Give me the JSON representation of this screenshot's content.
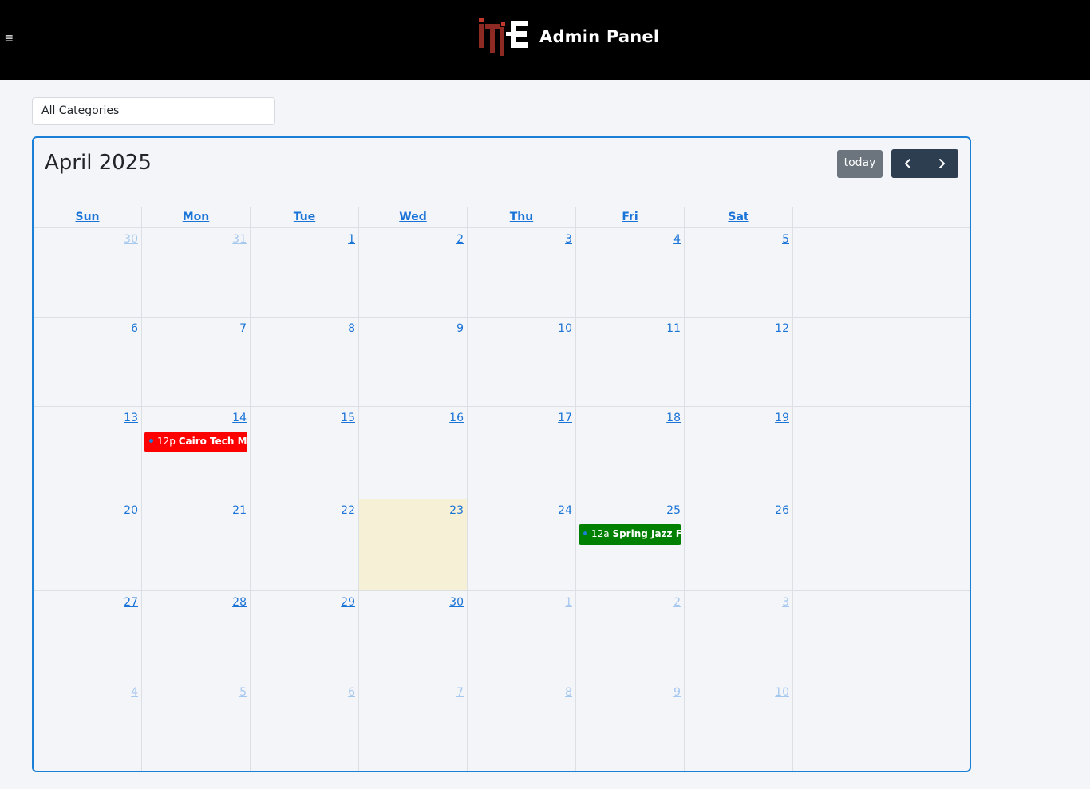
{
  "header": {
    "title": "Admin Panel",
    "menu_icon": "hamburger-icon"
  },
  "filter": {
    "selected": "All Categories"
  },
  "calendar": {
    "title": "April 2025",
    "today_label": "today",
    "weekdays": [
      "Sun",
      "Mon",
      "Tue",
      "Wed",
      "Thu",
      "Fri",
      "Sat"
    ],
    "weeks": [
      [
        {
          "d": "30",
          "o": true
        },
        {
          "d": "31",
          "o": true
        },
        {
          "d": "1"
        },
        {
          "d": "2"
        },
        {
          "d": "3"
        },
        {
          "d": "4"
        },
        {
          "d": "5"
        }
      ],
      [
        {
          "d": "6"
        },
        {
          "d": "7"
        },
        {
          "d": "8"
        },
        {
          "d": "9"
        },
        {
          "d": "10"
        },
        {
          "d": "11"
        },
        {
          "d": "12"
        }
      ],
      [
        {
          "d": "13"
        },
        {
          "d": "14",
          "event": {
            "time": "12p",
            "title": "Cairo Tech Meetup",
            "color": "#ff0000",
            "dot": "#1a7fd6"
          }
        },
        {
          "d": "15"
        },
        {
          "d": "16"
        },
        {
          "d": "17"
        },
        {
          "d": "18"
        },
        {
          "d": "19"
        }
      ],
      [
        {
          "d": "20"
        },
        {
          "d": "21"
        },
        {
          "d": "22"
        },
        {
          "d": "23",
          "today": true
        },
        {
          "d": "24"
        },
        {
          "d": "25",
          "event": {
            "time": "12a",
            "title": "Spring Jazz Festival",
            "color": "#008000",
            "dot": "#1a7fd6"
          }
        },
        {
          "d": "26"
        }
      ],
      [
        {
          "d": "27"
        },
        {
          "d": "28"
        },
        {
          "d": "29"
        },
        {
          "d": "30"
        },
        {
          "d": "1",
          "o": true
        },
        {
          "d": "2",
          "o": true
        },
        {
          "d": "3",
          "o": true
        }
      ],
      [
        {
          "d": "4",
          "o": true
        },
        {
          "d": "5",
          "o": true
        },
        {
          "d": "6",
          "o": true
        },
        {
          "d": "7",
          "o": true
        },
        {
          "d": "8",
          "o": true
        },
        {
          "d": "9",
          "o": true
        },
        {
          "d": "10",
          "o": true
        }
      ]
    ]
  },
  "colors": {
    "accent": "#1a73d6",
    "topbar": "#000000",
    "today_bg": "#f6f0d6",
    "nav_bg": "#2c3e50",
    "today_btn": "#6c757d"
  }
}
